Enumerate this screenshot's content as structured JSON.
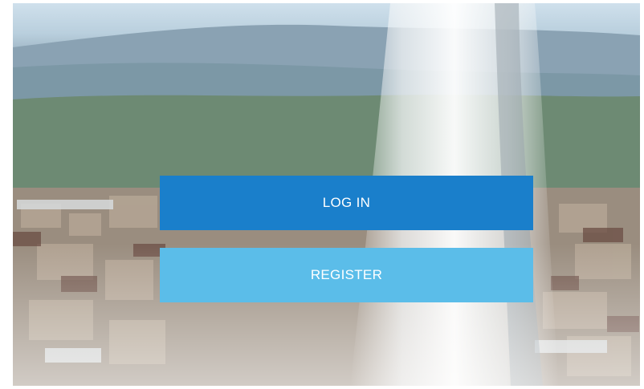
{
  "auth": {
    "login_label": "LOG IN",
    "register_label": "REGISTER"
  },
  "colors": {
    "login_button": "#1a7fcb",
    "register_button": "#5bbde9",
    "background": "#ffffff"
  },
  "background_image": {
    "subject": "city-skyline-with-water-fountain-photo"
  }
}
